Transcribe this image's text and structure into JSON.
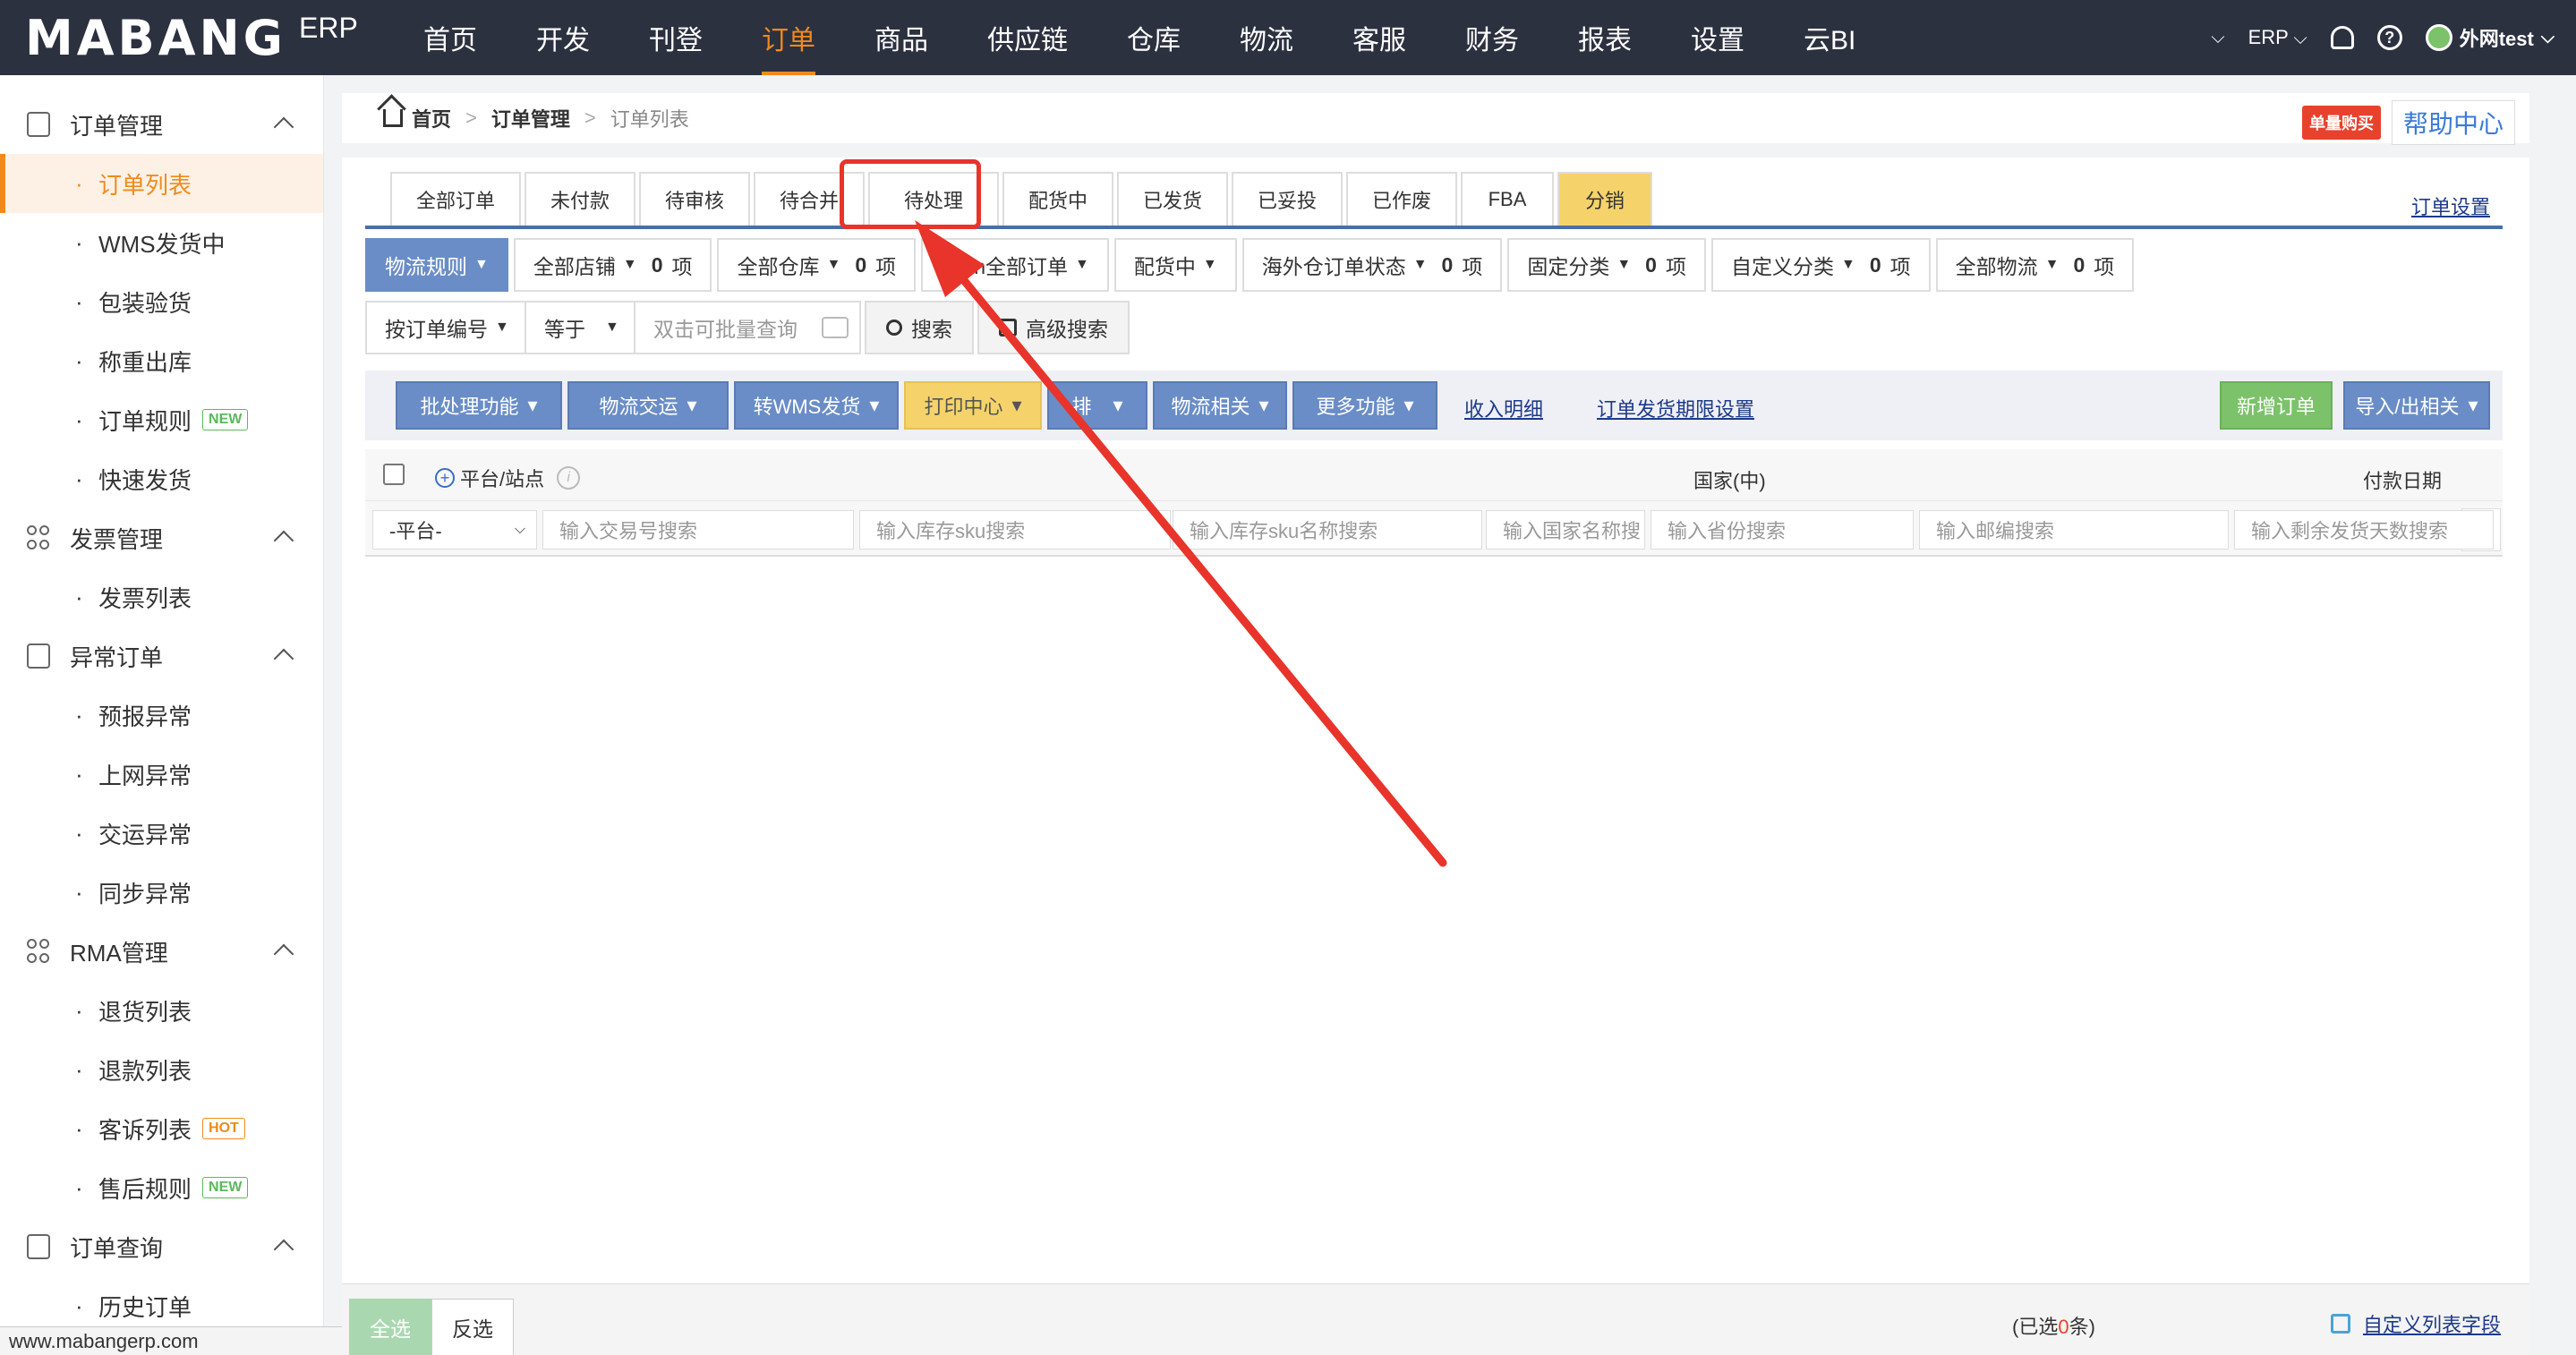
{
  "topnav": {
    "logo_text": "MABANG",
    "logo_sub": "ERP",
    "items": [
      "首页",
      "开发",
      "刊登",
      "订单",
      "商品",
      "供应链",
      "仓库",
      "物流",
      "客服",
      "财务",
      "报表",
      "设置",
      "云BI"
    ],
    "active_index": 3,
    "right": {
      "env": "ERP",
      "user": "外网test"
    }
  },
  "sidebar": {
    "groups": [
      {
        "label": "订单管理",
        "items": [
          {
            "label": "订单列表",
            "active": true
          },
          {
            "label": "WMS发货中"
          },
          {
            "label": "包装验货"
          },
          {
            "label": "称重出库"
          },
          {
            "label": "订单规则",
            "badge": "NEW"
          },
          {
            "label": "快速发货"
          }
        ]
      },
      {
        "label": "发票管理",
        "items": [
          {
            "label": "发票列表"
          }
        ]
      },
      {
        "label": "异常订单",
        "items": [
          {
            "label": "预报异常"
          },
          {
            "label": "上网异常"
          },
          {
            "label": "交运异常"
          },
          {
            "label": "同步异常"
          }
        ]
      },
      {
        "label": "RMA管理",
        "items": [
          {
            "label": "退货列表"
          },
          {
            "label": "退款列表"
          },
          {
            "label": "客诉列表",
            "badge": "HOT"
          },
          {
            "label": "售后规则",
            "badge": "NEW"
          }
        ]
      },
      {
        "label": "订单查询",
        "items": [
          {
            "label": "历史订单"
          }
        ]
      }
    ],
    "status_url": "www.mabangerp.com"
  },
  "breadcrumb": {
    "home": "首页",
    "level1": "订单管理",
    "current": "订单列表",
    "buy_label": "单量购买",
    "help_label": "帮助中心"
  },
  "tabs": [
    "全部订单",
    "未付款",
    "待审核",
    "待合并",
    "待处理",
    "配货中",
    "已发货",
    "已妥投",
    "已作废",
    "FBA",
    "分销"
  ],
  "tabs_active": "待处理",
  "order_settings": "订单设置",
  "filters": [
    {
      "label": "物流规则"
    },
    {
      "label": "全部店铺",
      "count": "0",
      "unit": "项"
    },
    {
      "label": "全部仓库",
      "count": "0",
      "unit": "项"
    },
    {
      "label": "azon全部订单"
    },
    {
      "label": "配货中"
    },
    {
      "label": "海外仓订单状态",
      "count": "0",
      "unit": "项"
    },
    {
      "label": "固定分类",
      "count": "0",
      "unit": "项"
    },
    {
      "label": "自定义分类",
      "count": "0",
      "unit": "项"
    },
    {
      "label": "全部物流",
      "count": "0",
      "unit": "项"
    }
  ],
  "search": {
    "field": "按订单编号",
    "op": "等于",
    "placeholder": "双击可批量查询",
    "search_label": "搜索",
    "advanced_label": "高级搜索"
  },
  "actions": {
    "batch": "批处理功能",
    "logistics": "物流交运",
    "wms": "转WMS发货",
    "print": "打印中心",
    "sort": "排",
    "logistics_related": "物流相关",
    "more": "更多功能",
    "income": "收入明细",
    "deadline": "订单发货期限设置",
    "new_order": "新增订单",
    "import_export": "导入/出相关"
  },
  "table": {
    "platform_header": "平台/站点",
    "country_header": "国家(中)",
    "pay_date_header": "付款日期",
    "platform_select": "-平台-",
    "placeholders": [
      "输入交易号搜索",
      "输入库存sku搜索",
      "输入库存sku名称搜索",
      "输入国家名称搜",
      "输入省份搜索",
      "输入邮编搜索",
      "输入剩余发货天数搜索"
    ]
  },
  "bottom": {
    "select_all": "全选",
    "invert": "反选",
    "selected_prefix": "(已选",
    "selected_count": "0",
    "selected_suffix": "条)",
    "custom_fields": "自定义列表字段"
  },
  "colors": {
    "nav_bg": "#2c3140",
    "accent": "#f08a1c",
    "blue_btn": "#6a8dc7",
    "annotation": "#e8342a"
  }
}
